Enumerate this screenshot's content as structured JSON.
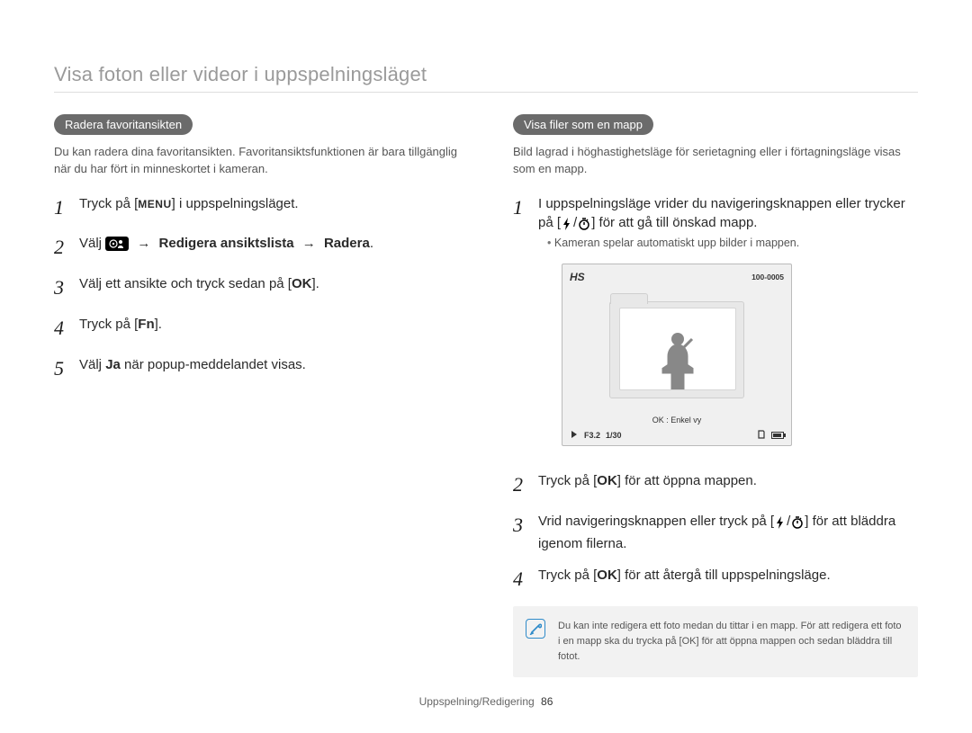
{
  "page_title": "Visa foton eller videor i uppspelningsläget",
  "icons": {
    "menu_label": "MENU",
    "ok_label": "OK",
    "fn_label": "Fn",
    "flash_alt": "flash",
    "timer_alt": "timer"
  },
  "left": {
    "pill": "Radera favoritansikten",
    "desc": "Du kan radera dina favoritansikten. Favoritansiktsfunktionen är bara tillgänglig när du har fört in minneskortet i kameran.",
    "steps": {
      "s1_a": "Tryck på [",
      "s1_b": "] i uppspelningsläget.",
      "s2_a": "Välj ",
      "s2_b": "Redigera ansiktslista",
      "s2_c": "Radera",
      "s3_a": "Välj ett ansikte och tryck sedan på [",
      "s3_b": "].",
      "s4_a": "Tryck på [",
      "s4_b": "].",
      "s5_a": "Välj ",
      "s5_b": "Ja",
      "s5_c": " när popup-meddelandet visas."
    }
  },
  "right": {
    "pill": "Visa filer som en mapp",
    "desc": "Bild lagrad i höghastighetsläge för serietagning eller i förtagningsläge visas som en mapp.",
    "steps": {
      "s1_a": "I uppspelningsläge vrider du navigeringsknappen eller trycker på [",
      "s1_b": "/",
      "s1_c": "] för att gå till önskad mapp.",
      "s1_note": "Kameran spelar automatiskt upp bilder i mappen.",
      "s2_a": "Tryck på [",
      "s2_b": "] för att öppna mappen.",
      "s3_a": "Vrid navigeringsknappen eller tryck på [",
      "s3_b": "/",
      "s3_c": "] för att bläddra igenom filerna.",
      "s4_a": "Tryck på [",
      "s4_b": "] för att återgå till uppspelningsläge."
    },
    "preview": {
      "hs": "HS",
      "file_id": "100-0005",
      "caption": "OK : Enkel vy",
      "footer_f": "F3.2",
      "footer_s": "1/30"
    },
    "tip": "Du kan inte redigera ett foto medan du tittar i en mapp. För att redigera ett foto i en mapp ska du trycka på [OK] för att öppna mappen och sedan bläddra till fotot."
  },
  "footer": {
    "label": "Uppspelning/Redigering",
    "num": "86"
  }
}
